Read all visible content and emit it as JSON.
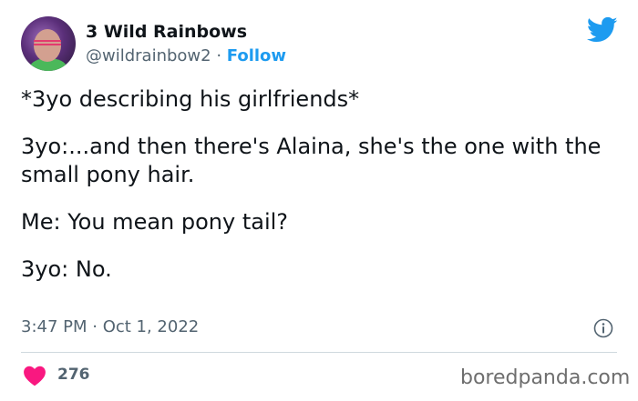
{
  "author": {
    "display_name": "3 Wild Rainbows",
    "handle": "@wildrainbow2",
    "separator": " · ",
    "follow_label": "Follow"
  },
  "tweet": {
    "lines": [
      "*3yo describing his girlfriends*",
      "3yo:...and then there's Alaina, she's the one with the small pony hair.",
      "Me: You mean pony tail?",
      "3yo: No."
    ],
    "timestamp": "3:47 PM · Oct 1, 2022",
    "like_count": "276"
  },
  "icons": {
    "brand": "twitter-bird-icon",
    "info": "info-icon",
    "like": "heart-icon"
  },
  "colors": {
    "accent": "#1d9bf0",
    "like": "#f91880",
    "muted_text": "#536471"
  },
  "watermark": "boredpanda.com"
}
